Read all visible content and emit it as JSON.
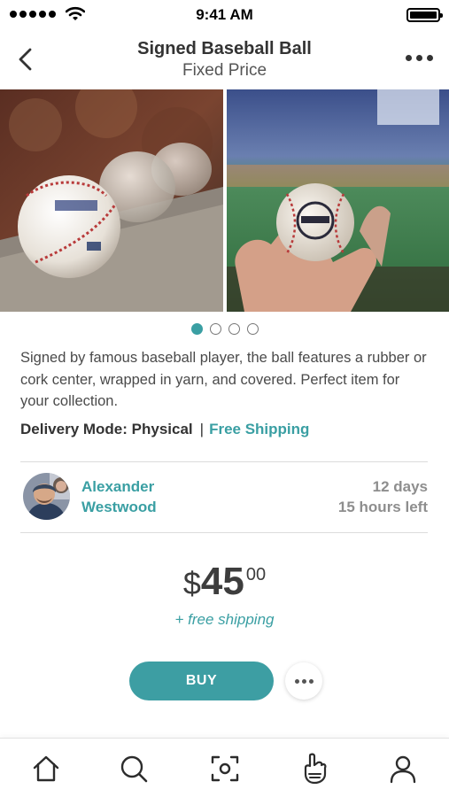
{
  "status_bar": {
    "time": "9:41 AM"
  },
  "header": {
    "title": "Signed Baseball Ball",
    "subtitle": "Fixed Price",
    "back_icon": "chevron-left-icon",
    "more_icon": "more-horizontal-icon"
  },
  "gallery": {
    "photos": [
      "baseballs-on-ledge",
      "baseball-held-in-stadium"
    ],
    "page_count": 4,
    "active_page": 1
  },
  "product": {
    "description": "Signed by famous baseball player, the ball features a rubber or cork center, wrapped in yarn, and covered. Perfect item for your collection.",
    "delivery_label": "Delivery Mode: Physical",
    "separator": "|",
    "shipping_label": "Free Shipping"
  },
  "seller": {
    "first_name": "Alexander",
    "last_name": "Westwood",
    "time_days": "12 days",
    "time_hours": "15 hours left"
  },
  "price": {
    "currency": "$",
    "amount": "45",
    "cents": "00",
    "shipping_note": "+ free shipping"
  },
  "actions": {
    "buy_label": "BUY"
  },
  "tab_bar": {
    "items": [
      "home-icon",
      "search-icon",
      "scan-icon",
      "foam-finger-icon",
      "profile-icon"
    ]
  },
  "colors": {
    "accent": "#3a9fa3",
    "text": "#3d3d3d",
    "muted": "#8e8e8e"
  }
}
